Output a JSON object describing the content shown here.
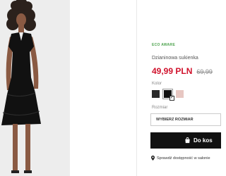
{
  "product": {
    "badge": "ECO AWARE",
    "title": "Dzianinowa sukienka",
    "price": "49,99 PLN",
    "old_price": "69,99"
  },
  "color": {
    "label": "Kolor",
    "swatches": [
      {
        "hex": "#2a2a2a",
        "selected": false
      },
      {
        "hex": "#111111",
        "selected": true
      },
      {
        "hex": "#e7c7c2",
        "selected": false
      }
    ]
  },
  "size": {
    "label": "Rozmiar",
    "select_text": "WYBIERZ ROZMIAR"
  },
  "cart": {
    "label": "Do kos"
  },
  "availability": {
    "text": "Sprawdź dostępność w salonie"
  },
  "colors": {
    "price": "#d0112b",
    "badge": "#4da34e",
    "button": "#111111"
  },
  "icons": {
    "cart": "cart-icon",
    "location": "location-pin-icon"
  }
}
